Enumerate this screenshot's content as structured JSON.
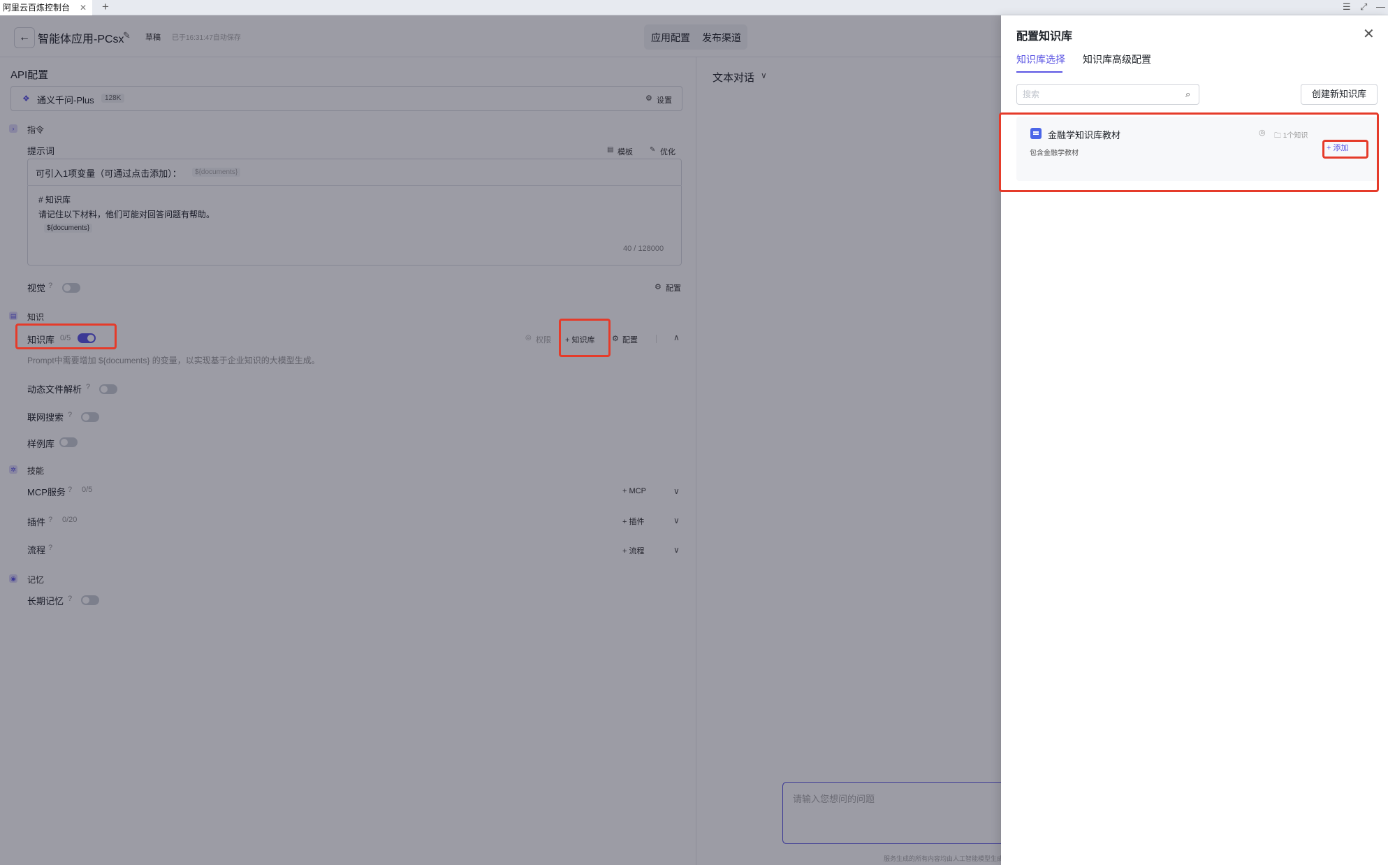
{
  "browser": {
    "tab_title": "阿里云百炼控制台",
    "close": "✕",
    "new_tab": "+",
    "menu": "☰",
    "expand": "⤢",
    "minimize": "—"
  },
  "header": {
    "back": "←",
    "title": "智能体应用-PCsx",
    "edit_icon": "✎",
    "status": "草稿",
    "saved_text": "已于16:31:47自动保存",
    "tabs": [
      "应用配置",
      "发布渠道"
    ]
  },
  "api": {
    "section_title": "API配置",
    "model_icon": "❖",
    "model_name": "通义千问-Plus",
    "model_ctx": "128K",
    "settings_icon": "⚙",
    "settings": "设置"
  },
  "instructions": {
    "section": "指令",
    "prompt_label": "提示词",
    "template_icon": "▤",
    "template": "模板",
    "optimize_icon": "✎",
    "optimize": "优化",
    "var_hint": "可引入1项变量（可通过点击添加）：",
    "var_chip": "${documents}",
    "prompt_lines": [
      "# 知识库",
      "请记住以下材料，他们可能对回答问题有帮助。"
    ],
    "prompt_var": "${documents}",
    "counter": "40 / 128000",
    "vision_label": "视觉",
    "help_icon": "?",
    "config_icon": "⚙",
    "config": "配置"
  },
  "knowledge": {
    "section": "知识",
    "kb_label": "知识库",
    "kb_count": "0/5",
    "permission_icon": "◎",
    "permission": "权限",
    "add_kb": "+ 知识库",
    "config_icon": "⚙",
    "config": "配置",
    "collapse_icon": "∧",
    "hint": "Prompt中需要增加 ${documents} 的变量，以实现基于企业知识的大模型生成。",
    "dynamic_file": "动态文件解析",
    "web_search": "联网搜索",
    "examples": "样例库"
  },
  "skills": {
    "section": "技能",
    "mcp_label": "MCP服务",
    "mcp_count": "0/5",
    "mcp_add": "+ MCP",
    "plugin_label": "插件",
    "plugin_count": "0/20",
    "plugin_add": "+ 插件",
    "flow_label": "流程",
    "flow_add": "+ 流程",
    "expand_icon": "∨"
  },
  "memory": {
    "section": "记忆",
    "long_term": "长期记忆"
  },
  "chat": {
    "mode": "文本对话",
    "mode_icon": "∨",
    "input_placeholder": "请输入您想问的问题",
    "footer": "服务生成的所有内容均由人工智能模型生成"
  },
  "drawer": {
    "title": "配置知识库",
    "close": "✕",
    "tab_select": "知识库选择",
    "tab_advanced": "知识库高级配置",
    "search_placeholder": "搜索",
    "search_icon": "⌕",
    "create_button": "创建新知识库",
    "card_title": "金融学知识库教材",
    "card_desc": "包含金融学教材",
    "card_eye": "◎",
    "card_count": "🗀 1个知识",
    "add_button": "+ 添加"
  },
  "colors": {
    "accent": "#5b55e3",
    "highlight": "#e53b2a",
    "overlay": "rgba(20,20,40,0.42)"
  }
}
